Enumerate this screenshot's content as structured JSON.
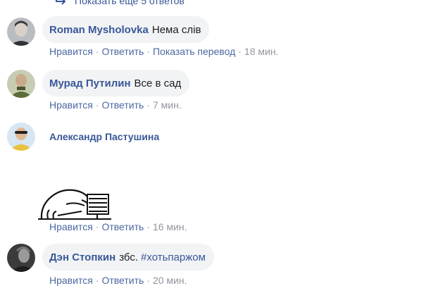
{
  "thread": {
    "more_replies_label": "Показать еще 5 ответов",
    "like_label": "Нравится",
    "reply_label": "Ответить",
    "translate_label": "Показать перевод",
    "separator": "·"
  },
  "comments": [
    {
      "author": "Roman Mysholovka",
      "text": "Нема слів",
      "time": "18 мин."
    },
    {
      "author": "Мурад Путилин",
      "text": "Все в сад",
      "time": "7 мин."
    },
    {
      "author": "Александр Пастушина",
      "sticker": "sleeping-face-on-laptop-sticker",
      "time": "16 мин."
    },
    {
      "author": "Дэн Стопкин",
      "text": "збс.",
      "hashtag": "#хотьпаржом",
      "time": "20 мин."
    }
  ],
  "colors": {
    "link": "#385898",
    "meta": "#90949c",
    "bubble": "#f2f3f5",
    "text": "#1c1e21"
  }
}
